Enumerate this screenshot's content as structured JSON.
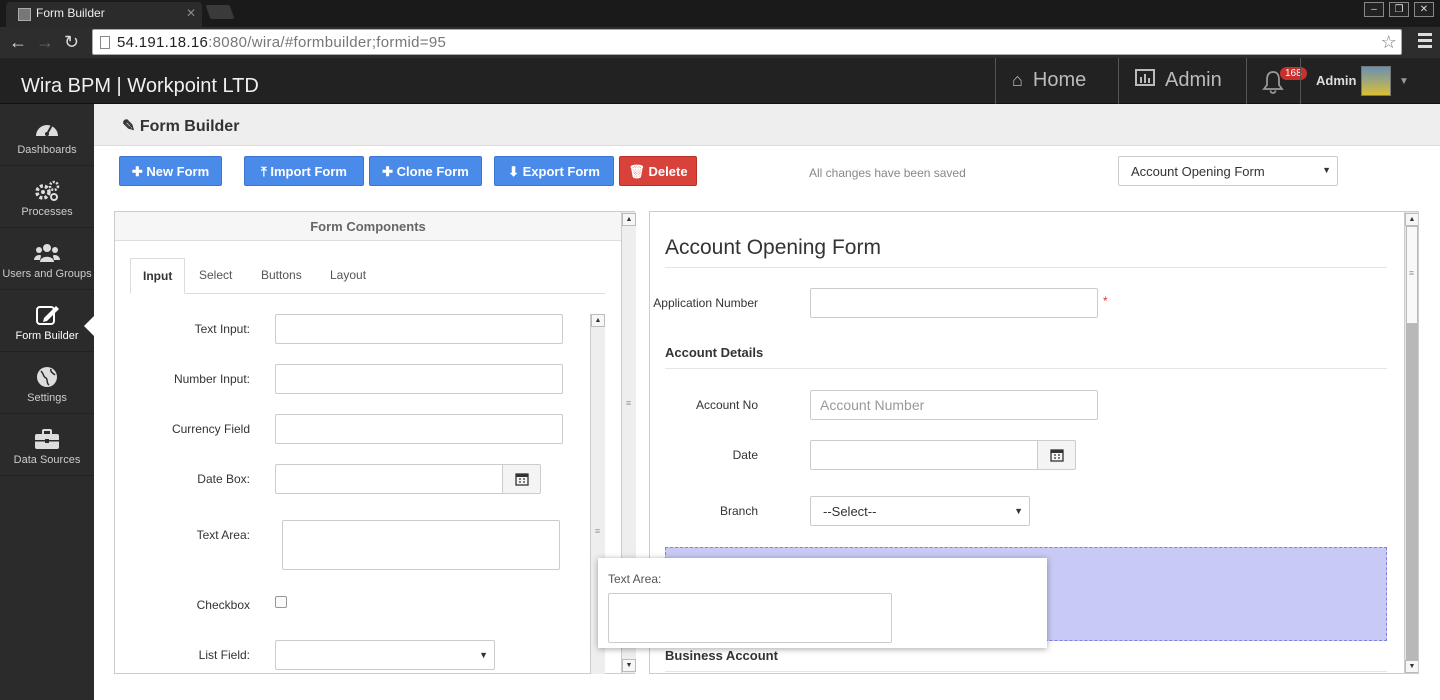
{
  "browser": {
    "tab_title": "Form Builder",
    "url_host": "54.191.18.16",
    "url_rest": ":8080/wira/#formbuilder;formid=95"
  },
  "header": {
    "brand": "Wira BPM | Workpoint LTD",
    "nav": [
      {
        "label": "Home",
        "icon": "home-icon"
      },
      {
        "label": "Admin",
        "icon": "bar-chart-icon"
      }
    ],
    "notifications_count": "168",
    "user": "Admin"
  },
  "sidebar": {
    "items": [
      {
        "label": "Dashboards",
        "icon": "dashboard-icon"
      },
      {
        "label": "Processes",
        "icon": "gears-icon"
      },
      {
        "label": "Users and Groups",
        "icon": "users-icon"
      },
      {
        "label": "Form Builder",
        "icon": "edit-icon",
        "active": true
      },
      {
        "label": "Settings",
        "icon": "globe-icon"
      },
      {
        "label": "Data Sources",
        "icon": "briefcase-icon"
      }
    ]
  },
  "page": {
    "title": "Form Builder",
    "buttons": {
      "new_form": "New Form",
      "import_form": "Import Form",
      "clone_form": "Clone Form",
      "export_form": "Export Form",
      "delete": "Delete"
    },
    "status": "All changes have been saved",
    "selected_form": "Account Opening Form"
  },
  "components": {
    "title": "Form Components",
    "tabs": [
      "Input",
      "Select",
      "Buttons",
      "Layout"
    ],
    "active_tab": "Input",
    "fields": {
      "text_input": "Text Input:",
      "number_input": "Number Input:",
      "currency": "Currency Field",
      "date_box": "Date Box:",
      "text_area": "Text Area:",
      "checkbox": "Checkbox",
      "list_field": "List Field:"
    }
  },
  "form": {
    "title": "Account Opening Form",
    "application_number_label": "Application Number",
    "required_mark": "*",
    "section_account_details": "Account Details",
    "account_no_label": "Account No",
    "account_no_placeholder": "Account Number",
    "date_label": "Date",
    "branch_label": "Branch",
    "branch_value": "--Select--",
    "section_business_account": "Business Account"
  },
  "drag_ghost": {
    "label": "Text Area:"
  },
  "colors": {
    "primary_button": "#4a8ae8",
    "danger_button": "#d9423a",
    "dropzone": "#c8caf5",
    "badge": "#c9302c",
    "dark_bar": "#222222"
  }
}
